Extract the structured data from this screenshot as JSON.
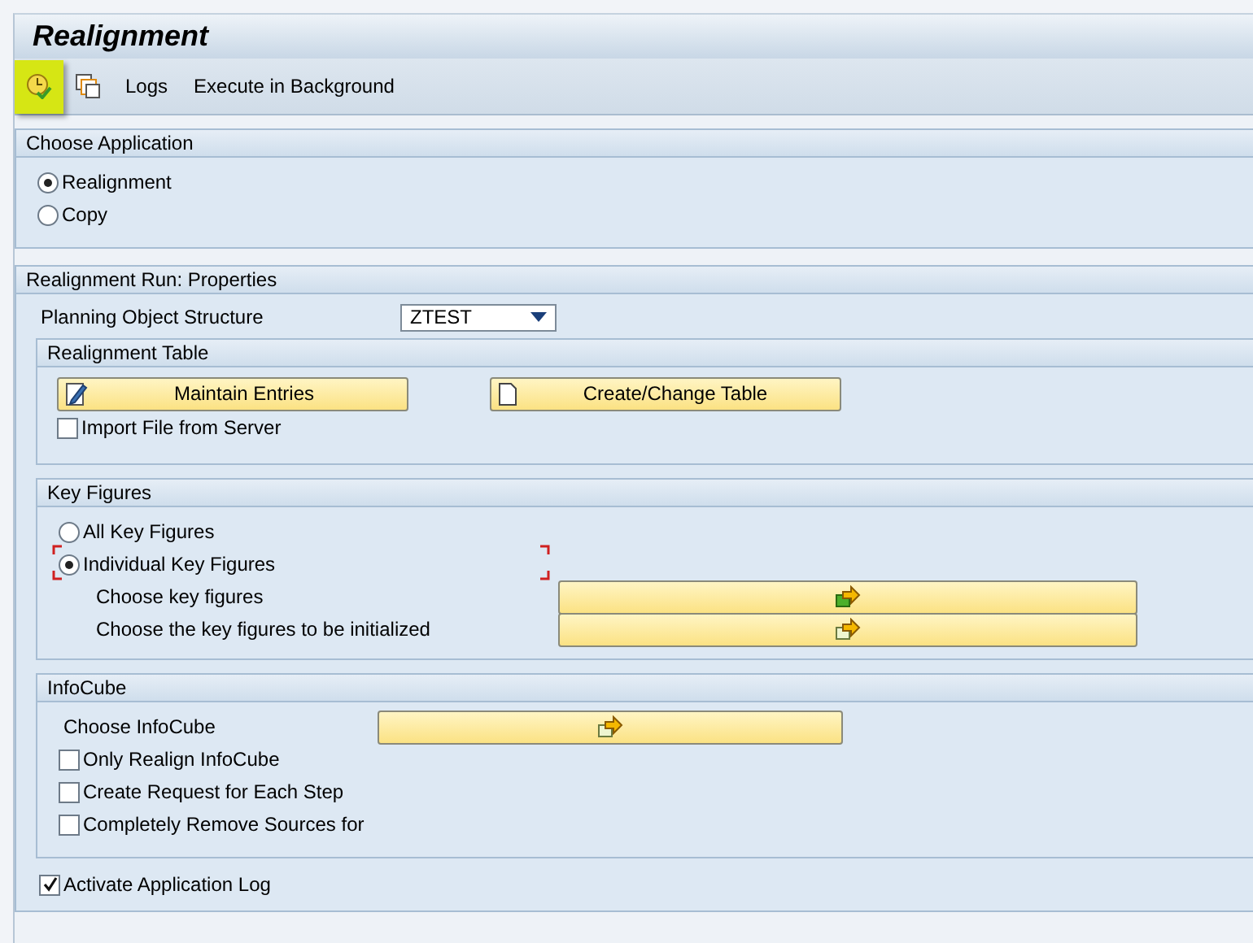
{
  "window": {
    "title": "Realignment"
  },
  "toolbar": [
    {
      "kind": "execute",
      "highlighted": true
    },
    {
      "kind": "windows",
      "highlighted": false
    },
    {
      "kind": "text",
      "label": "Logs",
      "highlighted": false
    },
    {
      "kind": "text",
      "label": "Execute in Background",
      "highlighted": false
    }
  ],
  "choose_application": {
    "title": "Choose Application",
    "options": [
      {
        "label": "Realignment",
        "selected": true
      },
      {
        "label": "Copy",
        "selected": false
      }
    ]
  },
  "properties": {
    "title": "Realignment Run: Properties",
    "planning_object_structure": {
      "label": "Planning Object Structure",
      "value": "ZTEST"
    },
    "realignment_table": {
      "title": "Realignment Table",
      "buttons": [
        {
          "label": "Maintain Entries"
        },
        {
          "label": "Create/Change Table"
        }
      ],
      "checkboxes": [
        {
          "label": "Import File from Server",
          "checked": false
        }
      ]
    },
    "key_figures": {
      "title": "Key Figures",
      "options": [
        {
          "label": "All Key Figures",
          "selected": false,
          "focused": false
        },
        {
          "label": "Individual Key Figures",
          "selected": true,
          "focused": true
        }
      ],
      "choosers": [
        {
          "label": "Choose key figures"
        },
        {
          "label": "Choose the key figures to be initialized"
        }
      ]
    },
    "infocube": {
      "title": "InfoCube",
      "chooser": {
        "label": "Choose InfoCube"
      },
      "checkboxes": [
        {
          "label": "Only Realign InfoCube",
          "checked": false
        },
        {
          "label": "Create Request for Each Step",
          "checked": false
        },
        {
          "label": "Completely Remove Sources for",
          "checked": false
        }
      ]
    },
    "activate_log": {
      "label": "Activate Application Log",
      "checked": true
    }
  }
}
